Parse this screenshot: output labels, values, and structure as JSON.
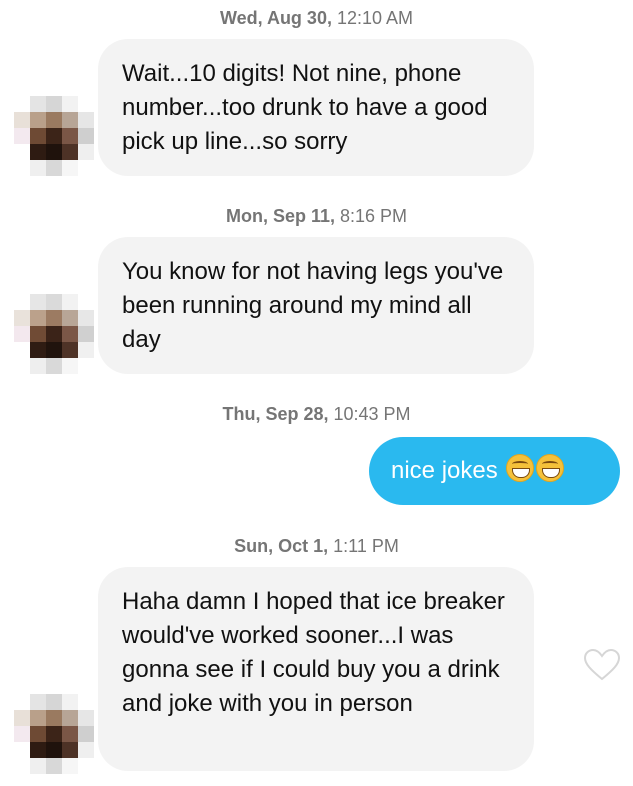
{
  "messages": [
    {
      "day": "Wed, Aug 30,",
      "time": "12:10 AM",
      "text": "Wait...10 digits! Not nine, phone number...too drunk to have a good pick up line...so sorry"
    },
    {
      "day": "Mon, Sep 11,",
      "time": "8:16 PM",
      "text": "You know for not having legs you've been running around my mind all day"
    },
    {
      "day": "Thu, Sep 28,",
      "time": "10:43 PM",
      "text": "nice jokes"
    },
    {
      "day": "Sun, Oct 1,",
      "time": "1:11 PM",
      "text": "Haha damn I hoped that ice breaker would've worked sooner...I was gonna see if I could buy you a drink and joke with you in person"
    }
  ],
  "icons": {
    "outgoing_emoji": "grinning-squinting-face-icon",
    "like": "heart-outline-icon",
    "avatar": "pixelated-avatar"
  },
  "colors": {
    "outgoing_bubble": "#2ab9ef",
    "incoming_bubble": "#f3f3f3",
    "timestamp": "#757575"
  }
}
